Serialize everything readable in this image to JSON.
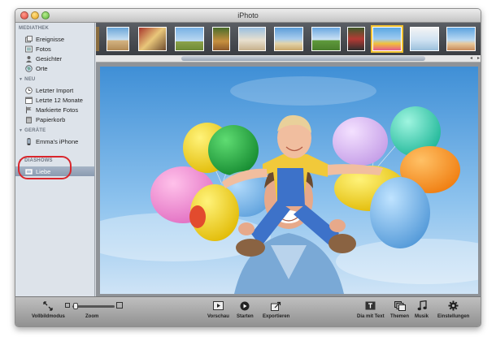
{
  "window": {
    "title": "iPhoto"
  },
  "sidebar": {
    "sections": [
      {
        "label": "MEDIATHEK",
        "items": [
          {
            "label": "Ereignisse",
            "icon": "events-icon"
          },
          {
            "label": "Fotos",
            "icon": "photos-icon"
          },
          {
            "label": "Gesichter",
            "icon": "faces-icon"
          },
          {
            "label": "Orte",
            "icon": "places-icon"
          }
        ]
      },
      {
        "label": "NEU",
        "items": [
          {
            "label": "Letzter Import",
            "icon": "clock-icon"
          },
          {
            "label": "Letzte 12 Monate",
            "icon": "calendar-icon"
          },
          {
            "label": "Markierte Fotos",
            "icon": "flag-icon"
          },
          {
            "label": "Papierkorb",
            "icon": "trash-icon"
          }
        ]
      },
      {
        "label": "GERÄTE",
        "items": [
          {
            "label": "Emma's iPhone",
            "icon": "iphone-icon"
          }
        ]
      },
      {
        "label": "DIASHOWS",
        "items": [
          {
            "label": "Liebe",
            "icon": "slideshow-icon",
            "selected": true
          }
        ]
      }
    ]
  },
  "toolbar": {
    "fullscreen_label": "Vollbildmodus",
    "zoom_label": "Zoom",
    "zoom_level": 0.05,
    "preview_label": "Vorschau",
    "play_label": "Starten",
    "export_label": "Exportieren",
    "title_slide_label": "Dia mit Text",
    "themes_label": "Themen",
    "music_label": "Musik",
    "settings_label": "Einstellungen"
  },
  "colors": {
    "selection": "#8a9ab0",
    "highlight_ring": "#d9262c",
    "sky": "#5aa7e3"
  }
}
